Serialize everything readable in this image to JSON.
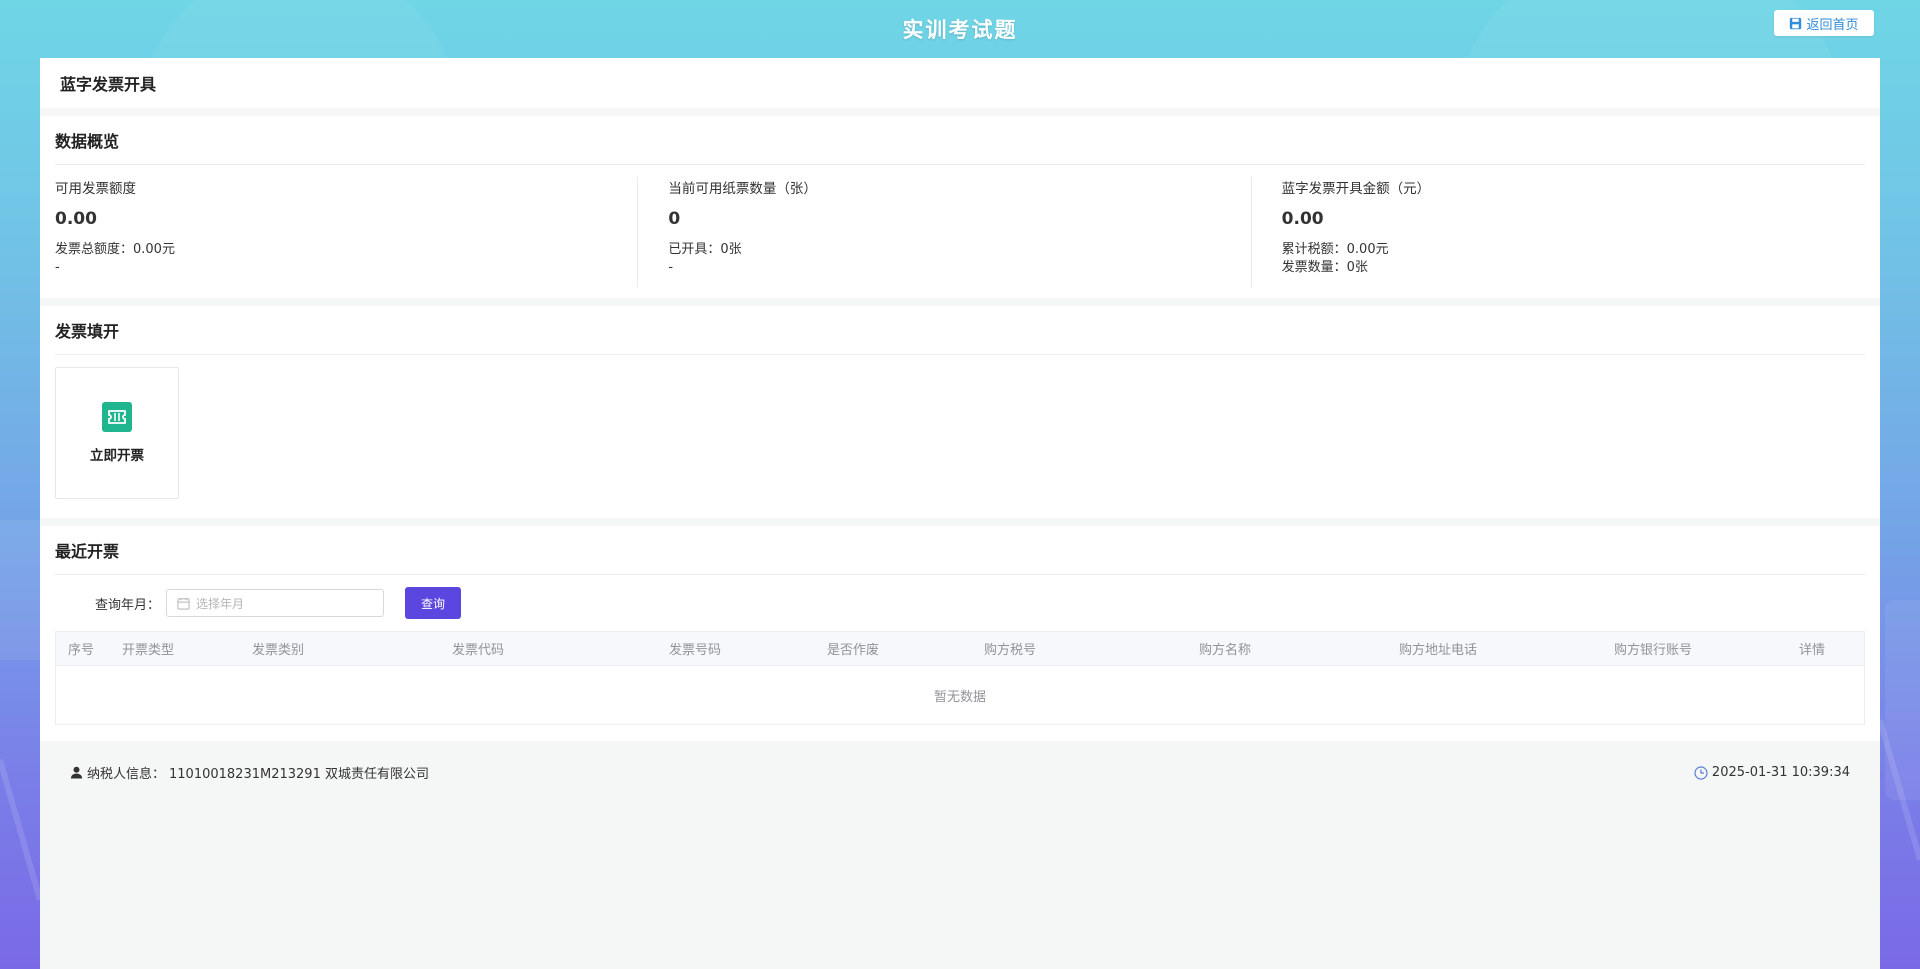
{
  "header": {
    "title": "实训考试题",
    "home_button": "返回首页"
  },
  "page": {
    "title": "蓝字发票开具"
  },
  "overview": {
    "title": "数据概览",
    "stats": [
      {
        "label": "可用发票额度",
        "value": "0.00",
        "sub1": "发票总额度：0.00元",
        "sub2": "-"
      },
      {
        "label": "当前可用纸票数量（张）",
        "value": "0",
        "sub1": "已开具：0张",
        "sub2": "-"
      },
      {
        "label": "蓝字发票开具金额（元）",
        "value": "0.00",
        "sub1": "累计税额：0.00元",
        "sub2": "发票数量：0张"
      }
    ]
  },
  "fill": {
    "title": "发票填开",
    "tile_label": "立即开票"
  },
  "recent": {
    "title": "最近开票",
    "query_label": "查询年月：",
    "date_placeholder": "选择年月",
    "query_button": "查询",
    "columns": [
      "序号",
      "开票类型",
      "发票类别",
      "发票代码",
      "发票号码",
      "是否作废",
      "购方税号",
      "购方名称",
      "购方地址电话",
      "购方银行账号",
      "详情"
    ],
    "empty_text": "暂无数据"
  },
  "footer": {
    "taxpayer_label": "纳税人信息：",
    "taxpayer_value": "11010018231M213291 双城责任有限公司",
    "datetime": "2025-01-31 10:39:34"
  },
  "colors": {
    "accent": "#5b47e0",
    "tile_icon": "#1fb58f",
    "home_text": "#2f8dd9"
  }
}
